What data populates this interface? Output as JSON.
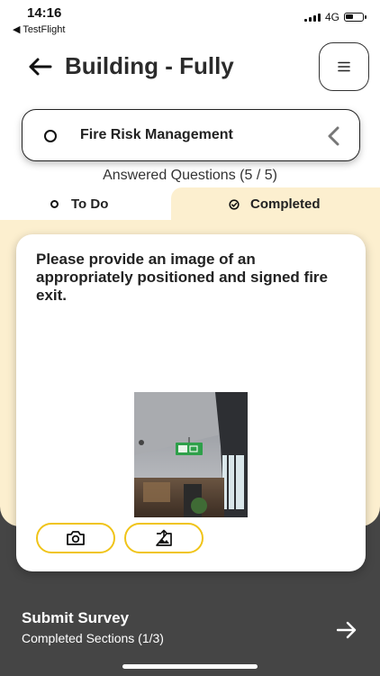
{
  "status_bar": {
    "time": "14:16",
    "back_app": "◀ TestFlight",
    "network": "4G"
  },
  "header": {
    "title": "Building - Fully",
    "back_icon": "arrow-left-icon",
    "menu_icon": "hamburger-icon"
  },
  "section": {
    "label": "Fire Risk Management",
    "status_icon": "circle-icon",
    "chevron_icon": "chevron-left-icon"
  },
  "answered": "Answered Questions (5 / 5)",
  "tabs": [
    {
      "label": "To Do",
      "icon": "circle-icon"
    },
    {
      "label": "Completed",
      "icon": "check-circle-icon",
      "active": true
    }
  ],
  "question": {
    "text": "Please provide an image of an appropriately positioned and signed fire exit.",
    "camera_icon": "camera-icon",
    "gallery_icon": "image-upload-icon"
  },
  "submit": {
    "title": "Submit Survey",
    "subtitle": "Completed Sections (1/3)",
    "arrow_icon": "arrow-right-icon"
  },
  "colors": {
    "accent_yellow": "#f0c419",
    "panel_cream": "#fcefcf",
    "dark_footer": "#454545",
    "exit_sign_green": "#2ea04a"
  }
}
